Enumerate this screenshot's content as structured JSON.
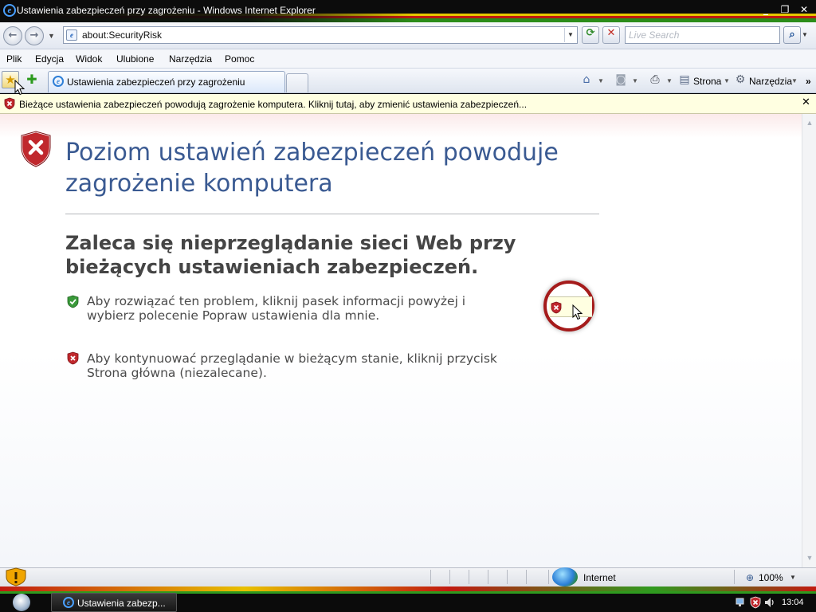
{
  "window": {
    "title": "Ustawienia zabezpieczeń przy zagrożeniu - Windows Internet Explorer",
    "controls": {
      "minimize": "_",
      "maximize": "❐",
      "close": "✕"
    }
  },
  "address_bar": {
    "url": "about:SecurityRisk",
    "search_placeholder": "Live Search"
  },
  "menu": [
    "Plik",
    "Edycja",
    "Widok",
    "Ulubione",
    "Narzędzia",
    "Pomoc"
  ],
  "tab": {
    "label": "Ustawienia zabezpieczeń przy zagrożeniu"
  },
  "toolbar": {
    "page_label": "Strona",
    "tools_label": "Narzędzia"
  },
  "info_bar": {
    "text": "Bieżące ustawienia zabezpieczeń powodują zagrożenie komputera. Kliknij tutaj, aby zmienić ustawienia zabezpieczeń..."
  },
  "page": {
    "heading": "Poziom ustawień zabezpieczeń powoduje zagrożenie komputera",
    "subheading": "Zaleca się nieprzeglądanie sieci Web przy bieżących ustawieniach zabezpieczeń.",
    "option1": "Aby rozwiązać ten problem, kliknij pasek informacji powyżej i wybierz polecenie Popraw ustawienia dla mnie.",
    "option2": "Aby kontynuować przeglądanie w bieżącym stanie, kliknij przycisk Strona główna (niezalecane)."
  },
  "status_bar": {
    "zone": "Internet",
    "zoom": "100%"
  },
  "taskbar": {
    "button_label": "Ustawienia zabezp...",
    "clock": "13:04"
  },
  "icons": {
    "back": "back-arrow-icon",
    "forward": "forward-arrow-icon",
    "refresh": "refresh-icon",
    "stop": "stop-icon",
    "search": "magnifier-icon",
    "home": "home-icon",
    "feeds": "rss-icon",
    "print": "printer-icon",
    "page": "page-icon",
    "tools": "gear-icon",
    "shield": "shield-error-icon"
  },
  "colors": {
    "heading": "#3a5a92",
    "shield_red": "#c0282d",
    "shield_green": "#3a9a3a",
    "info_bar": "#ffffe1"
  }
}
